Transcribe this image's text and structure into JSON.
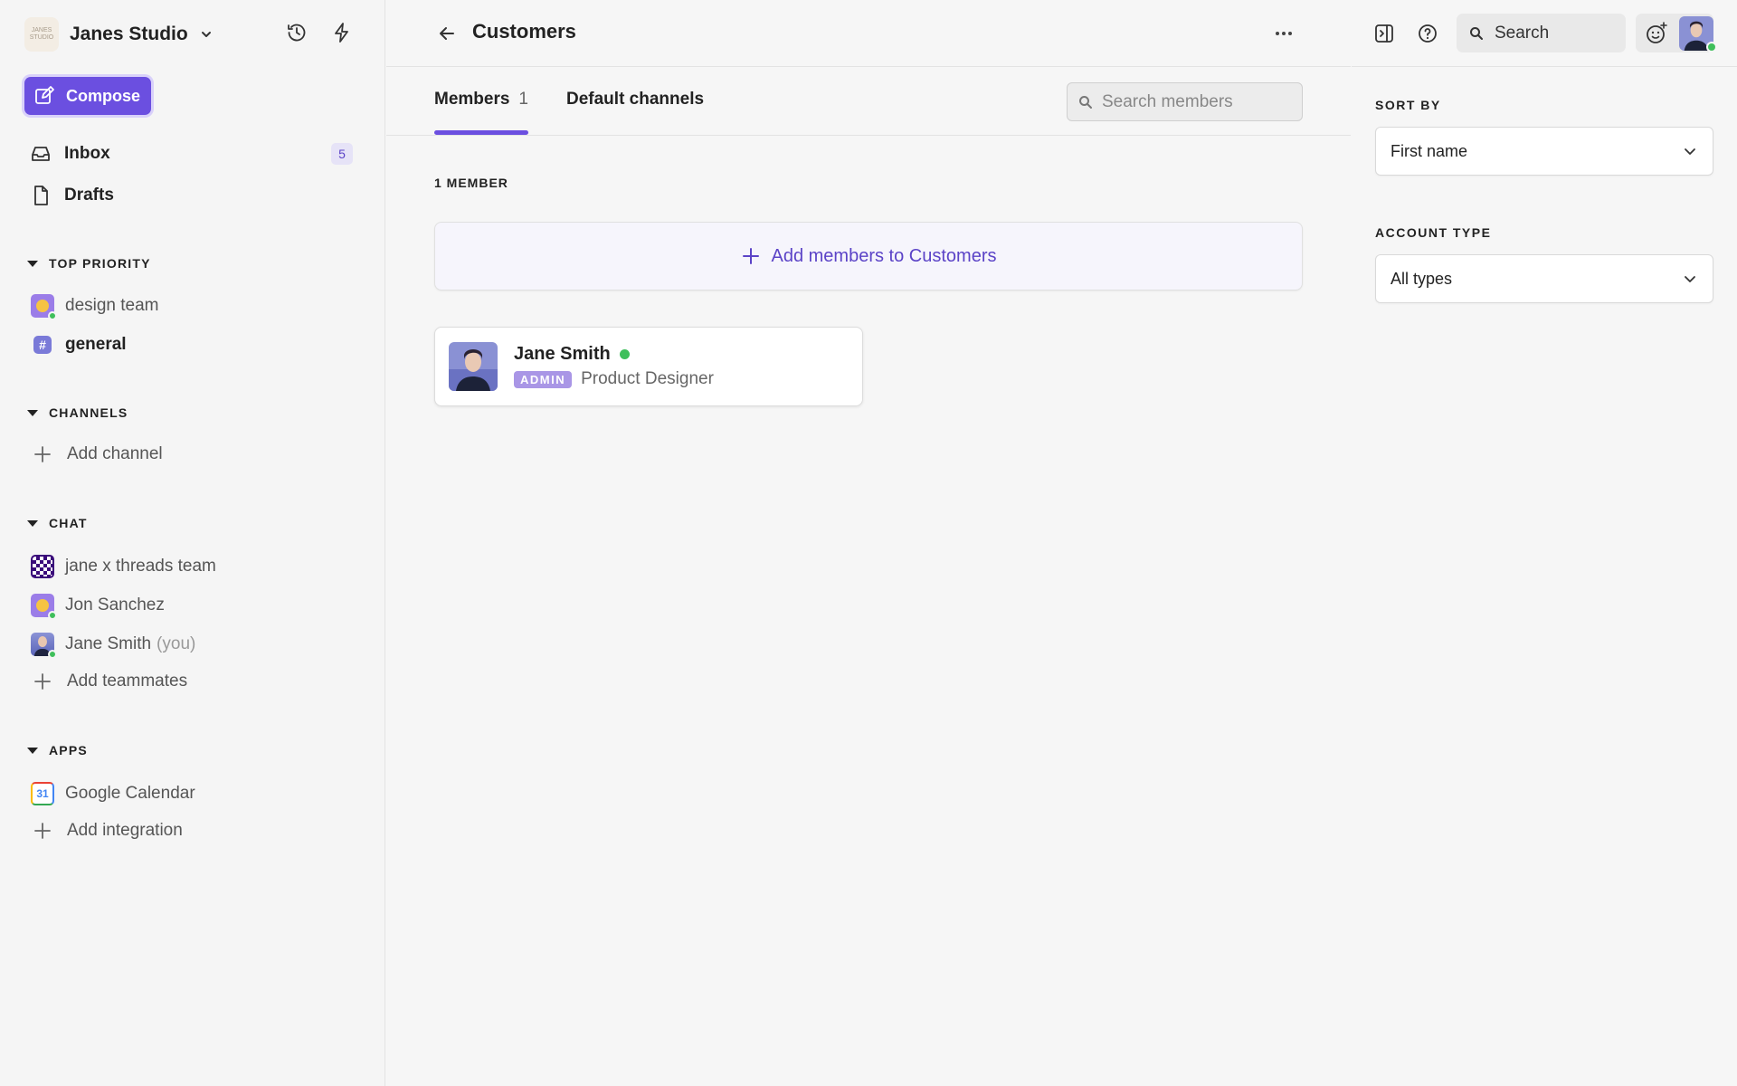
{
  "workspace": {
    "name": "Janes Studio",
    "logo_text": "JANES STUDIO"
  },
  "sidebar": {
    "compose_label": "Compose",
    "inbox": {
      "label": "Inbox",
      "count": "5"
    },
    "drafts": {
      "label": "Drafts"
    },
    "sections": {
      "top_priority": "TOP PRIORITY",
      "channels": "CHANNELS",
      "chat": "CHAT",
      "apps": "APPS"
    },
    "top_priority_items": [
      {
        "label": "design team",
        "icon": "team-avatar"
      },
      {
        "label": "general",
        "icon": "hash-icon"
      }
    ],
    "add_channel": "Add channel",
    "chat_items": [
      {
        "label": "jane x threads team"
      },
      {
        "label": "Jon Sanchez"
      },
      {
        "label": "Jane Smith",
        "suffix": "(you)"
      }
    ],
    "add_teammates": "Add teammates",
    "apps_items": [
      {
        "label": "Google Calendar",
        "icon_text": "31"
      }
    ],
    "add_integration": "Add integration"
  },
  "main": {
    "title": "Customers",
    "tabs": [
      {
        "label": "Members",
        "count": "1"
      },
      {
        "label": "Default channels"
      }
    ],
    "search_placeholder": "Search members",
    "member_count_label": "1 MEMBER",
    "add_members_label": "Add members to Customers",
    "members": [
      {
        "name": "Jane Smith",
        "badge": "ADMIN",
        "role": "Product Designer",
        "online": true
      }
    ]
  },
  "right_panel": {
    "search_label": "Search",
    "sort_by_label": "SORT BY",
    "sort_by_value": "First name",
    "account_type_label": "ACCOUNT TYPE",
    "account_type_value": "All types"
  },
  "colors": {
    "accent": "#6b4fe0",
    "online": "#3fbf5b",
    "admin_badge": "#a996e6"
  }
}
